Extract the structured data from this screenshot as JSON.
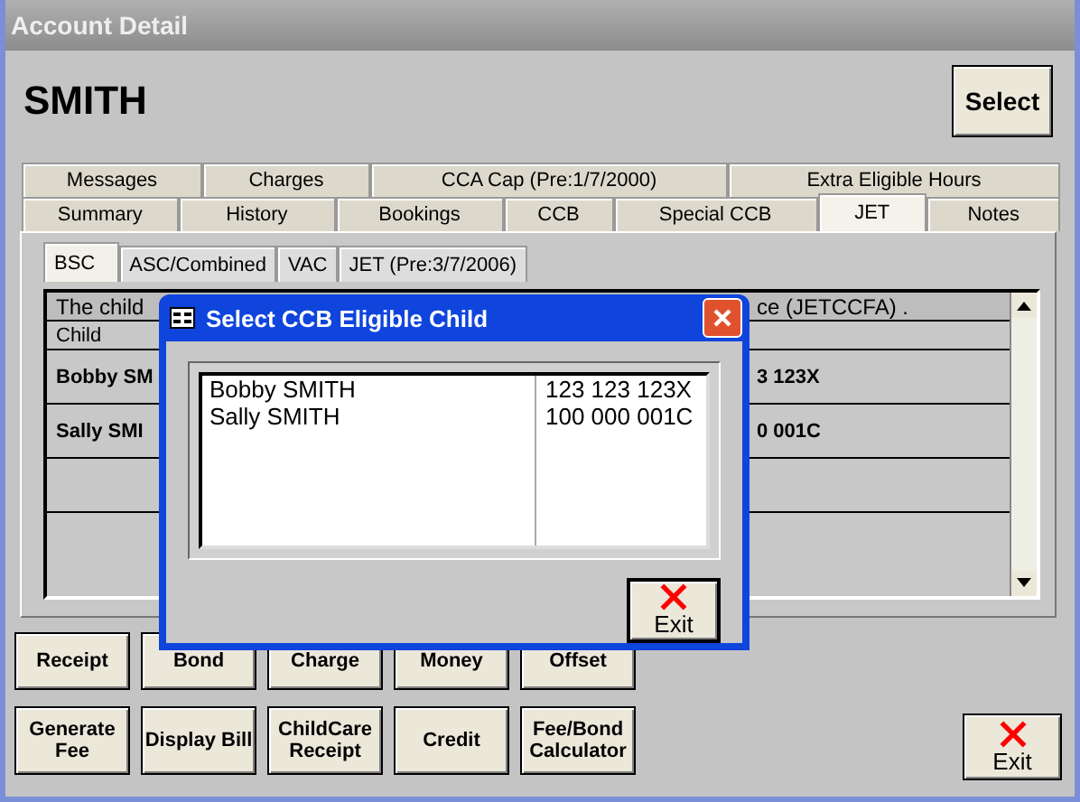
{
  "window": {
    "title": "Account Detail"
  },
  "customer_name": "SMITH",
  "select_button": "Select",
  "tabs_row1": [
    {
      "label": "Messages",
      "selected": false
    },
    {
      "label": "Charges",
      "selected": false
    },
    {
      "label": "CCA Cap (Pre:1/7/2000)",
      "selected": false
    },
    {
      "label": "Extra Eligible Hours",
      "selected": false
    }
  ],
  "tabs_row2": [
    {
      "label": "Summary",
      "selected": false
    },
    {
      "label": "History",
      "selected": false
    },
    {
      "label": "Bookings",
      "selected": false
    },
    {
      "label": "CCB",
      "selected": false
    },
    {
      "label": "Special CCB",
      "selected": false
    },
    {
      "label": "JET",
      "selected": true
    },
    {
      "label": "Notes",
      "selected": false
    }
  ],
  "subtabs": [
    {
      "label": "BSC",
      "selected": true
    },
    {
      "label": "ASC/Combined",
      "selected": false
    },
    {
      "label": "VAC",
      "selected": false
    },
    {
      "label": "JET (Pre:3/7/2006)",
      "selected": false
    }
  ],
  "grid": {
    "note_left": "The child",
    "note_right": "ce (JETCCFA) .",
    "column_header": "Child",
    "rows": [
      {
        "left": "Bobby SM",
        "right": "3 123X"
      },
      {
        "left": "Sally SMI",
        "right": "0 001C"
      }
    ]
  },
  "dialog": {
    "title": "Select CCB Eligible Child",
    "items": [
      {
        "name": "Bobby SMITH",
        "crn": "123 123 123X"
      },
      {
        "name": "Sally SMITH",
        "crn": "100 000 001C"
      }
    ],
    "exit_button": "Exit"
  },
  "button_rows": [
    [
      "Receipt",
      "Bond",
      "Charge",
      "Money",
      "Offset"
    ],
    [
      "Generate Fee",
      "Display Bill",
      "ChildCare Receipt",
      "Credit",
      "Fee/Bond Calculator"
    ]
  ],
  "exit_button": "Exit"
}
